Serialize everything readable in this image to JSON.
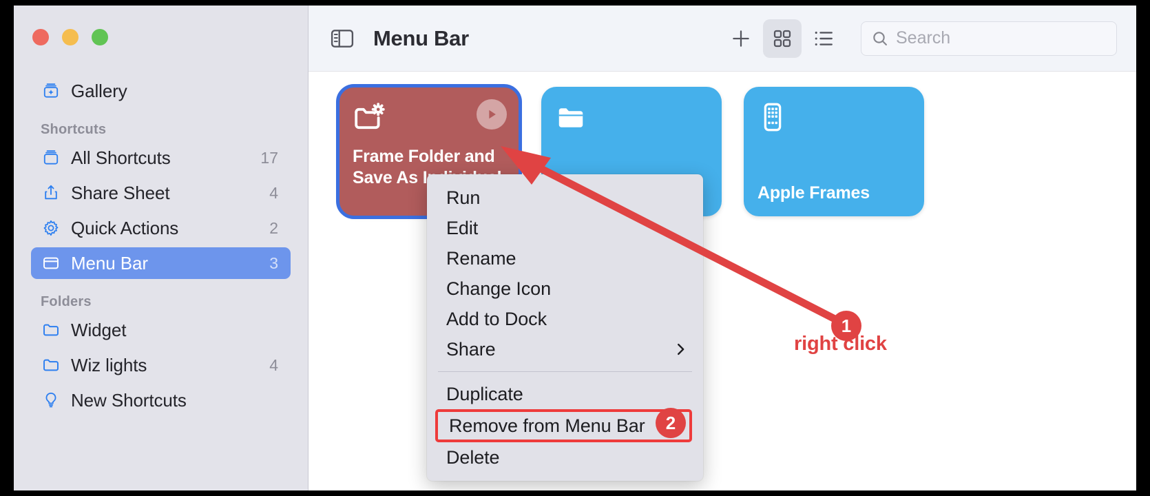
{
  "window": {
    "traffic_lights": [
      {
        "name": "close",
        "color": "#ee6a5f"
      },
      {
        "name": "minimize",
        "color": "#f5bd4f"
      },
      {
        "name": "zoom",
        "color": "#61c454"
      }
    ]
  },
  "sidebar": {
    "gallery": {
      "label": "Gallery",
      "icon": "gallery-icon"
    },
    "sections": [
      {
        "header": "Shortcuts",
        "items": [
          {
            "label": "All Shortcuts",
            "count": "17",
            "icon": "shortcuts-stack-icon",
            "selected": false
          },
          {
            "label": "Share Sheet",
            "count": "4",
            "icon": "share-icon",
            "selected": false
          },
          {
            "label": "Quick Actions",
            "count": "2",
            "icon": "gear-icon",
            "selected": false
          },
          {
            "label": "Menu Bar",
            "count": "3",
            "icon": "menubar-icon",
            "selected": true
          }
        ]
      },
      {
        "header": "Folders",
        "items": [
          {
            "label": "Widget",
            "count": "",
            "icon": "folder-icon",
            "selected": false
          },
          {
            "label": "Wiz lights",
            "count": "4",
            "icon": "folder-icon",
            "selected": false
          },
          {
            "label": "New Shortcuts",
            "count": "",
            "icon": "lightbulb-icon",
            "selected": false
          }
        ]
      }
    ]
  },
  "toolbar": {
    "sidebar_toggle_icon": "sidebar-toggle-icon",
    "title": "Menu Bar",
    "add_icon": "plus-icon",
    "grid_view_icon": "grid-view-icon",
    "list_view_icon": "list-view-icon",
    "search_icon": "search-icon",
    "search_placeholder": "Search",
    "search_value": ""
  },
  "grid": {
    "cards": [
      {
        "title": "Frame Folder and Save As Individual",
        "color": "#b15c5c",
        "icon": "folder-gear-icon",
        "selected": true,
        "has_run_button": true,
        "run_icon": "play-icon"
      },
      {
        "title": "",
        "color": "#45b0eb",
        "icon": "folder-icon",
        "selected": false,
        "has_run_button": false
      },
      {
        "title": "Apple Frames",
        "color": "#45b0eb",
        "icon": "iphone-icon",
        "selected": false,
        "has_run_button": false
      }
    ]
  },
  "context_menu": {
    "items": [
      {
        "label": "Run",
        "submenu": false,
        "highlighted": false
      },
      {
        "label": "Edit",
        "submenu": false,
        "highlighted": false
      },
      {
        "label": "Rename",
        "submenu": false,
        "highlighted": false
      },
      {
        "label": "Change Icon",
        "submenu": false,
        "highlighted": false
      },
      {
        "label": "Add to Dock",
        "submenu": false,
        "highlighted": false
      },
      {
        "label": "Share",
        "submenu": true,
        "highlighted": false
      },
      {
        "separator": true
      },
      {
        "label": "Duplicate",
        "submenu": false,
        "highlighted": false
      },
      {
        "label": "Remove from Menu Bar",
        "submenu": false,
        "highlighted": true
      },
      {
        "label": "Delete",
        "submenu": false,
        "highlighted": false
      }
    ]
  },
  "annotations": {
    "accent_color": "#e04343",
    "badge_1": "1",
    "badge_2": "2",
    "label_1": "right click"
  }
}
